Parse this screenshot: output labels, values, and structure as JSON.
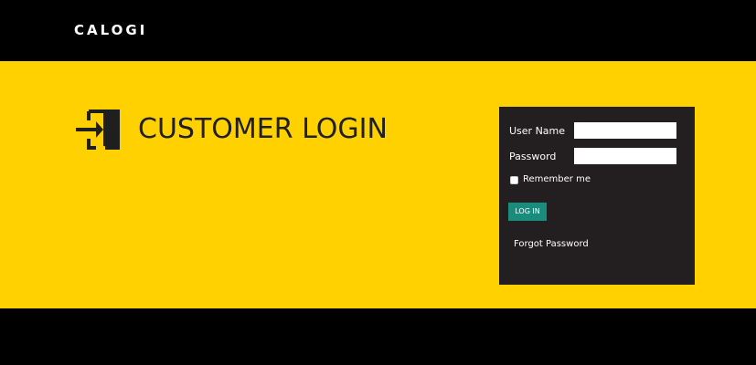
{
  "header": {
    "logo_text": "CALOGI"
  },
  "hero": {
    "title": "CUSTOMER LOGIN",
    "icon": "sign-in-icon"
  },
  "login_form": {
    "username_label": "User Name",
    "username_value": "",
    "password_label": "Password",
    "password_value": "",
    "remember_label": "Remember me",
    "remember_checked": false,
    "login_button_label": "LOG IN",
    "forgot_link_label": "Forgot Password"
  },
  "colors": {
    "header_bg": "#000000",
    "band_bg": "#ffd100",
    "panel_bg": "#231f20",
    "button_bg": "#1a8c7e",
    "heading_text": "#1f1f1f"
  }
}
